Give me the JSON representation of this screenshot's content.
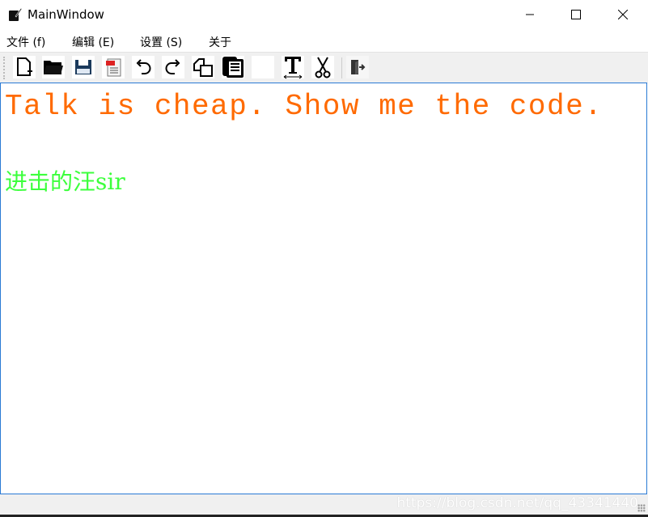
{
  "window": {
    "title": "MainWindow",
    "controls": [
      "minimize",
      "maximize",
      "close"
    ]
  },
  "menubar": {
    "items": [
      "文件 (f)",
      "编辑 (E)",
      "设置 (S)",
      "关于"
    ]
  },
  "toolbar": {
    "items": [
      "new-file-icon",
      "open-folder-icon",
      "save-icon",
      "pdf-icon",
      "undo-icon",
      "redo-icon",
      "copy-icon",
      "paste-icon",
      "color-icon",
      "font-icon",
      "cut-icon",
      "exit-icon"
    ]
  },
  "editor": {
    "line1": "Talk is cheap. Show me the code.",
    "line2": "进击的汪sir",
    "colors": {
      "line1": "#ff6a00",
      "line2": "#3cff3c"
    }
  },
  "statusbar": {
    "watermark": "https://blog.csdn.net/qq_43341440"
  }
}
